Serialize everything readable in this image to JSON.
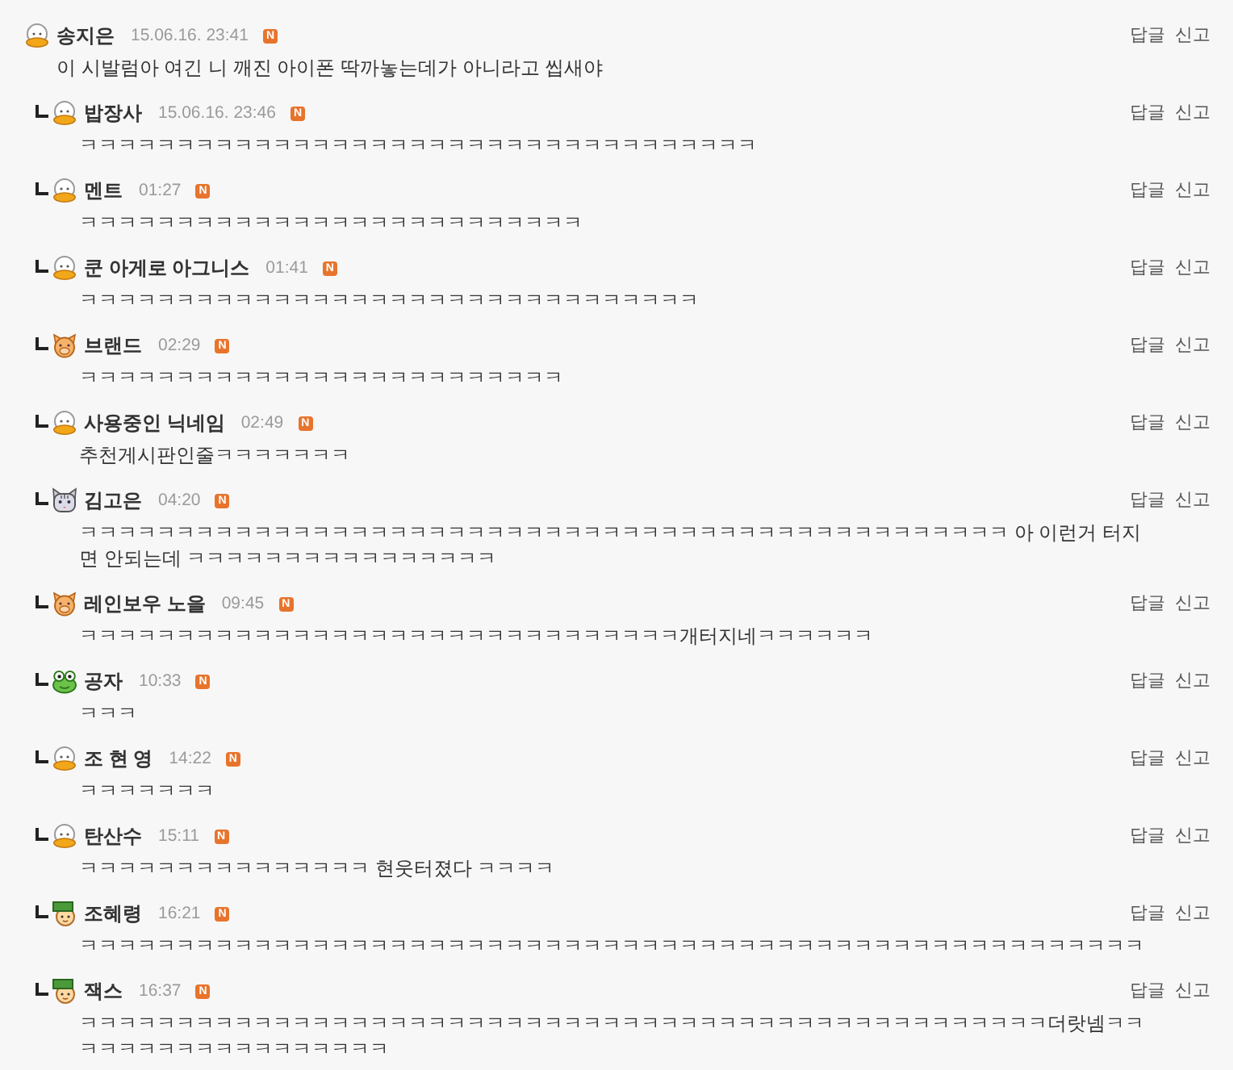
{
  "comments": [
    {
      "author": "송지은",
      "avatar": {
        "kind": "duck"
      },
      "time": "15.06.16. 23:41",
      "badge": "N",
      "actions": [
        "답글",
        "신고"
      ],
      "text": "이 시발럼아 여긴 니 깨진 아이폰 딱까놓는데가 아니라고 씹새야",
      "children": [
        {
          "author": "밥장사",
          "avatar": {
            "kind": "duck"
          },
          "time": "15.06.16. 23:46",
          "badge": "N",
          "actions": [
            "답글",
            "신고"
          ],
          "text": "ㅋㅋㅋㅋㅋㅋㅋㅋㅋㅋㅋㅋㅋㅋㅋㅋㅋㅋㅋㅋㅋㅋㅋㅋㅋㅋㅋㅋㅋㅋㅋㅋㅋㅋㅋ"
        },
        {
          "author": "멘트",
          "avatar": {
            "kind": "duck"
          },
          "time": "01:27",
          "badge": "N",
          "actions": [
            "답글",
            "신고"
          ],
          "text": "ㅋㅋㅋㅋㅋㅋㅋㅋㅋㅋㅋㅋㅋㅋㅋㅋㅋㅋㅋㅋㅋㅋㅋㅋㅋㅋ"
        },
        {
          "author": "쿤 아게로 아그니스",
          "avatar": {
            "kind": "duck"
          },
          "time": "01:41",
          "badge": "N",
          "actions": [
            "답글",
            "신고"
          ],
          "text": "ㅋㅋㅋㅋㅋㅋㅋㅋㅋㅋㅋㅋㅋㅋㅋㅋㅋㅋㅋㅋㅋㅋㅋㅋㅋㅋㅋㅋㅋㅋㅋㅋ"
        },
        {
          "author": "브랜드",
          "avatar": {
            "kind": "pig"
          },
          "time": "02:29",
          "badge": "N",
          "actions": [
            "답글",
            "신고"
          ],
          "text": "ㅋㅋㅋㅋㅋㅋㅋㅋㅋㅋㅋㅋㅋㅋㅋㅋㅋㅋㅋㅋㅋㅋㅋㅋㅋ"
        },
        {
          "author": "사용중인 닉네임",
          "avatar": {
            "kind": "duck"
          },
          "time": "02:49",
          "badge": "N",
          "actions": [
            "답글",
            "신고"
          ],
          "text": "추천게시판인줄ㅋㅋㅋㅋㅋㅋㅋ"
        },
        {
          "author": "김고은",
          "avatar": {
            "kind": "cat"
          },
          "time": "04:20",
          "badge": "N",
          "actions": [
            "답글",
            "신고"
          ],
          "text": "ㅋㅋㅋㅋㅋㅋㅋㅋㅋㅋㅋㅋㅋㅋㅋㅋㅋㅋㅋㅋㅋㅋㅋㅋㅋㅋㅋㅋㅋㅋㅋㅋㅋㅋㅋㅋㅋㅋㅋㅋㅋㅋㅋㅋㅋㅋㅋㅋ 아 이런거 터지면 안되는데 ㅋㅋㅋㅋㅋㅋㅋㅋㅋㅋㅋㅋㅋㅋㅋㅋ"
        },
        {
          "author": "레인보우 노을",
          "avatar": {
            "kind": "pig"
          },
          "time": "09:45",
          "badge": "N",
          "actions": [
            "답글",
            "신고"
          ],
          "text": "ㅋㅋㅋㅋㅋㅋㅋㅋㅋㅋㅋㅋㅋㅋㅋㅋㅋㅋㅋㅋㅋㅋㅋㅋㅋㅋㅋㅋㅋㅋㅋ개터지네ㅋㅋㅋㅋㅋㅋ"
        },
        {
          "author": "공자",
          "avatar": {
            "kind": "frog"
          },
          "time": "10:33",
          "badge": "N",
          "actions": [
            "답글",
            "신고"
          ],
          "text": "ㅋㅋㅋ"
        },
        {
          "author": "조 현 영",
          "avatar": {
            "kind": "duck"
          },
          "time": "14:22",
          "badge": "N",
          "actions": [
            "답글",
            "신고"
          ],
          "text": "ㅋㅋㅋㅋㅋㅋㅋ"
        },
        {
          "author": "탄산수",
          "avatar": {
            "kind": "duck"
          },
          "time": "15:11",
          "badge": "N",
          "actions": [
            "답글",
            "신고"
          ],
          "text": "ㅋㅋㅋㅋㅋㅋㅋㅋㅋㅋㅋㅋㅋㅋㅋ 현웃터졌다 ㅋㅋㅋㅋ"
        },
        {
          "author": "조혜령",
          "avatar": {
            "kind": "cap"
          },
          "time": "16:21",
          "badge": "N",
          "actions": [
            "답글",
            "신고"
          ],
          "text": "ㅋㅋㅋㅋㅋㅋㅋㅋㅋㅋㅋㅋㅋㅋㅋㅋㅋㅋㅋㅋㅋㅋㅋㅋㅋㅋㅋㅋㅋㅋㅋㅋㅋㅋㅋㅋㅋㅋㅋㅋㅋㅋㅋㅋㅋㅋㅋㅋㅋㅋㅋㅋㅋㅋㅋ"
        },
        {
          "author": "잭스",
          "avatar": {
            "kind": "cap"
          },
          "time": "16:37",
          "badge": "N",
          "actions": [
            "답글",
            "신고"
          ],
          "text": "ㅋㅋㅋㅋㅋㅋㅋㅋㅋㅋㅋㅋㅋㅋㅋㅋㅋㅋㅋㅋㅋㅋㅋㅋㅋㅋㅋㅋㅋㅋㅋㅋㅋㅋㅋㅋㅋㅋㅋㅋㅋㅋㅋㅋㅋㅋㅋㅋㅋㅋ더랏넴ㅋㅋㅋㅋㅋㅋㅋㅋㅋㅋㅋㅋㅋㅋㅋㅋㅋㅋ"
        }
      ]
    }
  ]
}
